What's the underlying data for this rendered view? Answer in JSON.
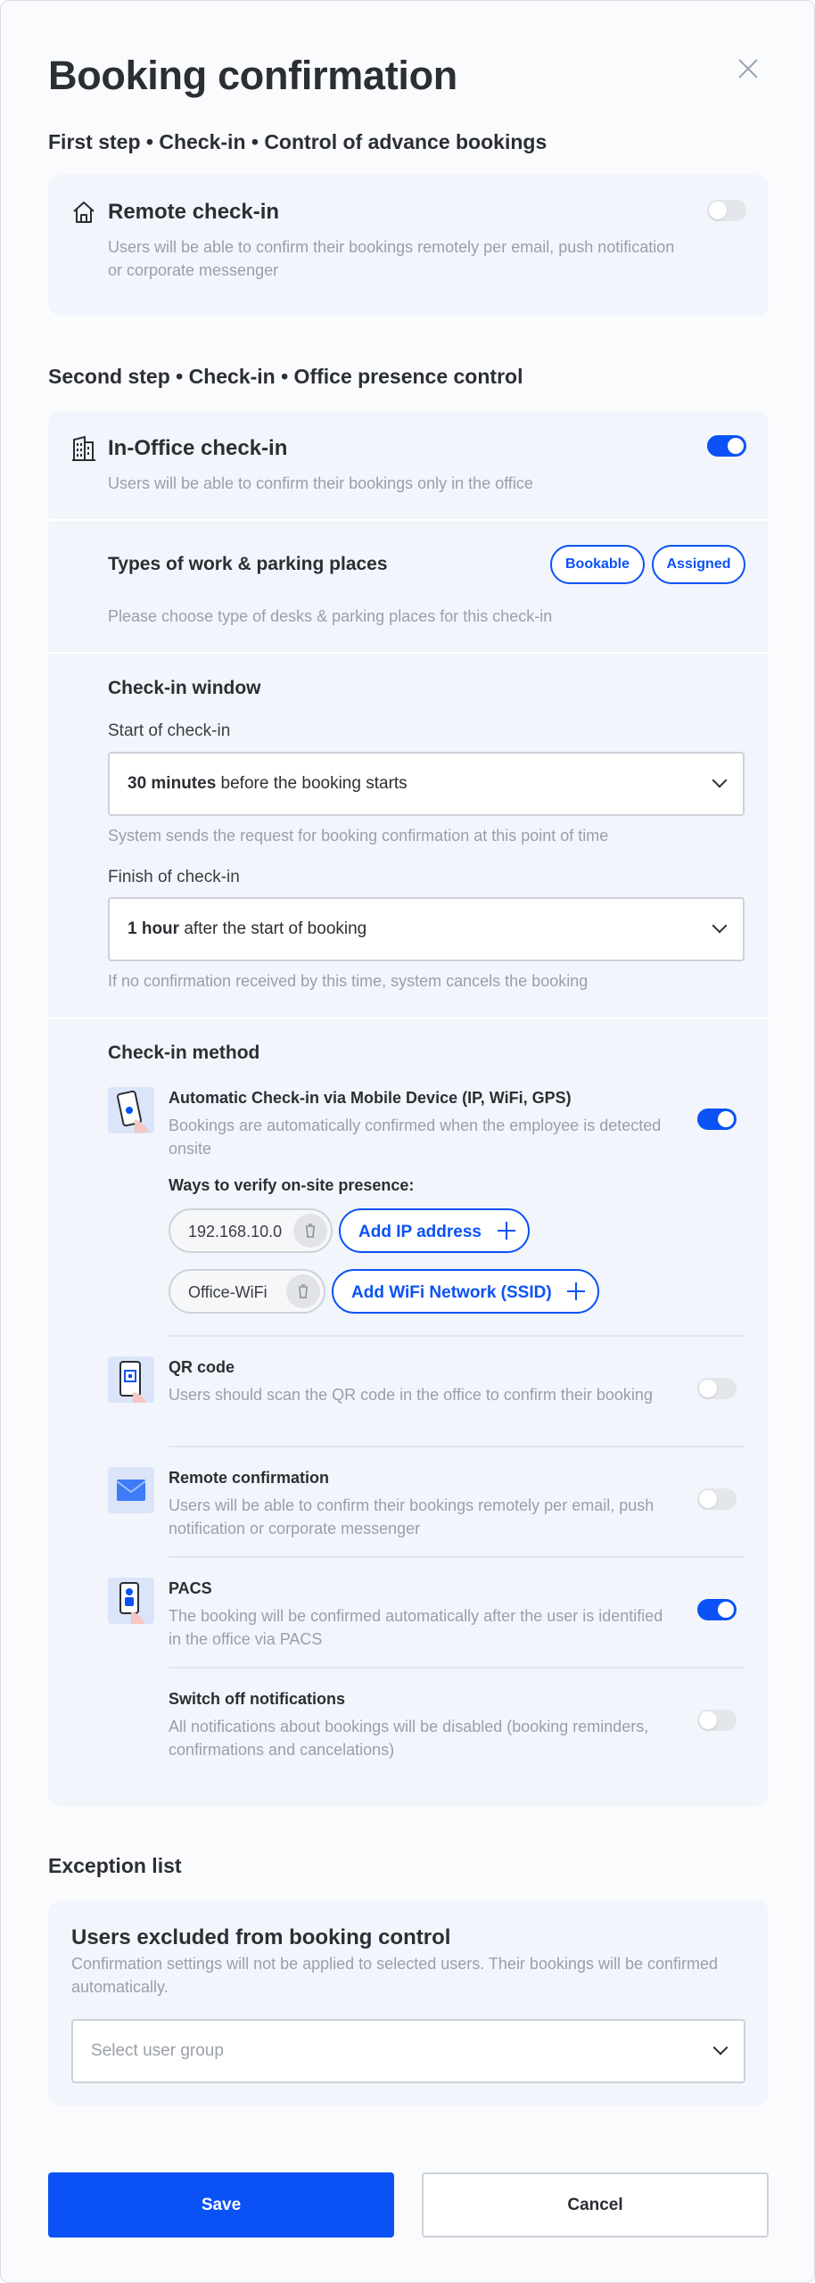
{
  "dialog": {
    "title": "Booking confirmation"
  },
  "step1": {
    "title": "First step • Check-in • Control of advance bookings",
    "remote": {
      "title": "Remote check-in",
      "description": "Users will be able to confirm their bookings remotely per email, push notification or corporate messenger",
      "enabled": false
    }
  },
  "step2": {
    "title": "Second step • Check-in • Office presence control",
    "in_office": {
      "title": "In-Office check-in",
      "description": "Users will be able to confirm their bookings only in the office",
      "enabled": true
    },
    "types": {
      "title": "Types of work & parking places",
      "description": "Please choose type of desks & parking places for this check-in",
      "chips": [
        "Bookable",
        "Assigned"
      ]
    },
    "window": {
      "title": "Check-in window",
      "start_label": "Start of check-in",
      "start_value_bold": "30 minutes",
      "start_value_rest": " before the booking starts",
      "start_hint": "System sends the request for booking confirmation at this point of time",
      "finish_label": "Finish of check-in",
      "finish_value_bold": "1 hour",
      "finish_value_rest": " after the start of booking",
      "finish_hint": "If no confirmation received by this time, system cancels the booking"
    },
    "method": {
      "title": "Check-in method",
      "items": [
        {
          "title": "Automatic Check-in via Mobile Device (IP, WiFi, GPS)",
          "description": "Bookings are automatically confirmed when the employee is detected onsite",
          "enabled": true
        },
        {
          "title": "QR code",
          "description": "Users should scan the QR code in the office to confirm their booking",
          "enabled": false
        },
        {
          "title": "Remote confirmation",
          "description": "Users will be able to confirm their bookings remotely per email, push notification or corporate messenger",
          "enabled": false
        },
        {
          "title": "PACS",
          "description": "The booking will be confirmed automatically after the user is identified in the office via PACS",
          "enabled": true
        },
        {
          "title": "Switch off notifications",
          "description": "All notifications about bookings will be disabled (booking reminders, confirmations and cancelations)",
          "enabled": false
        }
      ],
      "verify": {
        "title": "Ways to verify on-site presence:",
        "ip": "192.168.10.0",
        "add_ip": "Add IP address",
        "wifi": "Office-WiFi",
        "add_wifi": "Add WiFi Network (SSID)"
      }
    }
  },
  "exceptions": {
    "title": "Exception list",
    "card_title": "Users excluded from booking control",
    "description": "Confirmation settings will not be applied to selected users. Their bookings will be confirmed automatically.",
    "select_placeholder": "Select user group"
  },
  "footer": {
    "save": "Save",
    "cancel": "Cancel"
  },
  "colors": {
    "accent": "#0a52f5",
    "card": "#f2f5fb"
  }
}
